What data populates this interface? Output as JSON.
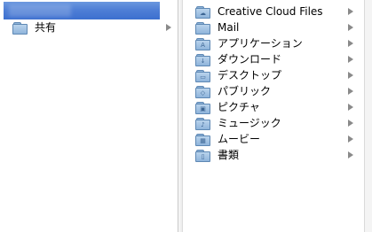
{
  "left_column": {
    "items": [
      {
        "label": "共有",
        "icon": "folder-shared-icon"
      }
    ]
  },
  "right_column": {
    "items": [
      {
        "label": "Creative Cloud Files",
        "icon": "creative-cloud-folder-icon",
        "glyph": "☁"
      },
      {
        "label": "Mail",
        "icon": "folder-icon",
        "glyph": ""
      },
      {
        "label": "アプリケーション",
        "icon": "applications-folder-icon",
        "glyph": "A"
      },
      {
        "label": "ダウンロード",
        "icon": "downloads-folder-icon",
        "glyph": "↓"
      },
      {
        "label": "デスクトップ",
        "icon": "desktop-folder-icon",
        "glyph": "▭"
      },
      {
        "label": "パブリック",
        "icon": "public-folder-icon",
        "glyph": "◇"
      },
      {
        "label": "ピクチャ",
        "icon": "pictures-folder-icon",
        "glyph": "▣"
      },
      {
        "label": "ミュージック",
        "icon": "music-folder-icon",
        "glyph": "♪"
      },
      {
        "label": "ムービー",
        "icon": "movies-folder-icon",
        "glyph": "▦"
      },
      {
        "label": "書類",
        "icon": "documents-folder-icon",
        "glyph": "▯"
      }
    ]
  },
  "colors": {
    "selection": "#4f7fd6",
    "folder_fill": "#a9c7e6",
    "folder_stroke": "#5e88b4",
    "arrow": "#8a8a8a"
  }
}
